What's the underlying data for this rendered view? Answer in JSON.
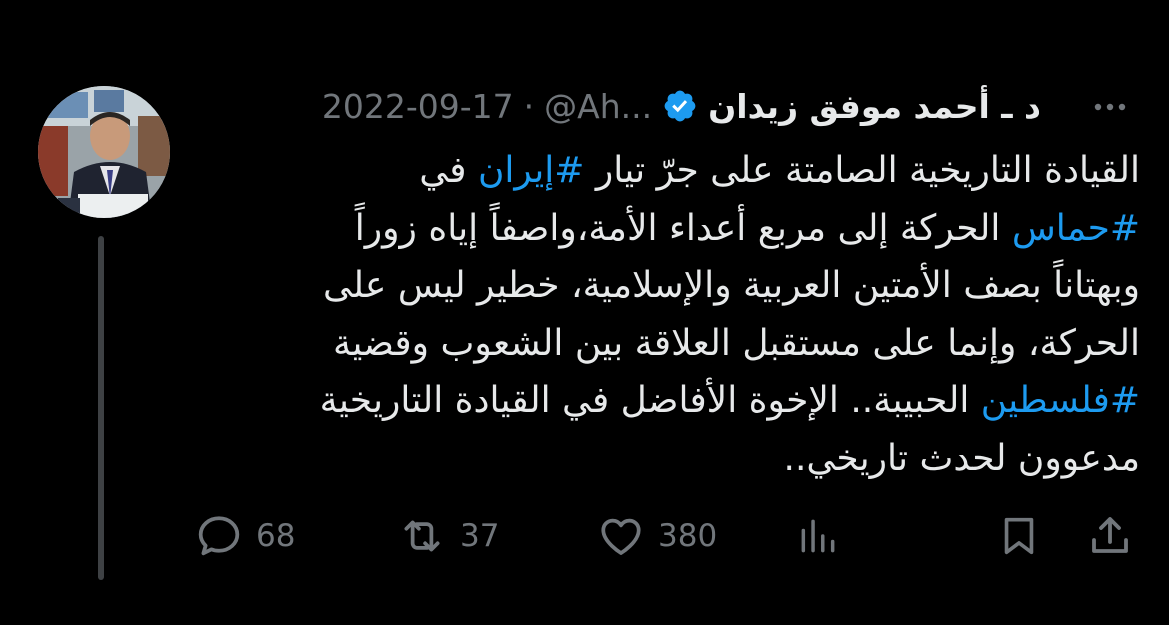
{
  "tweet": {
    "author_name": "د ـ أحمد موفق زيدان",
    "handle": "@Ah...",
    "separator": "·",
    "date": "2022-09-17",
    "more_label": "···",
    "lines": [
      [
        {
          "text": "القيادة التاريخية الصامتة على جرّ تيار "
        },
        {
          "text": "#إيران",
          "tag": true
        },
        {
          "text": " في"
        }
      ],
      [
        {
          "text": "#حماس",
          "tag": true
        },
        {
          "text": " الحركة إلى مربع أعداء الأمة،واصفاً إياه زوراً"
        }
      ],
      [
        {
          "text": "وبهتاناً بصف الأمتين العربية والإسلامية، خطير ليس على"
        }
      ],
      [
        {
          "text": "الحركة، وإنما على مستقبل العلاقة بين الشعوب وقضية"
        }
      ],
      [
        {
          "text": "#فلسطين",
          "tag": true
        },
        {
          "text": " الحبيبة.. الإخوة الأفاضل في القيادة التاريخية"
        }
      ],
      [
        {
          "text": "مدعوون لحدث تاريخي.."
        }
      ]
    ]
  },
  "actions": {
    "reply_count": "68",
    "retweet_count": "37",
    "like_count": "380"
  },
  "colors": {
    "background": "#000000",
    "text": "#e7e9ea",
    "secondary": "#71767b",
    "accent": "#1d9bf0",
    "thread_line": "#3e4144"
  },
  "icons": [
    "reply-icon",
    "retweet-icon",
    "like-icon",
    "views-icon",
    "bookmark-icon",
    "share-icon",
    "verified-badge-icon",
    "more-icon"
  ]
}
